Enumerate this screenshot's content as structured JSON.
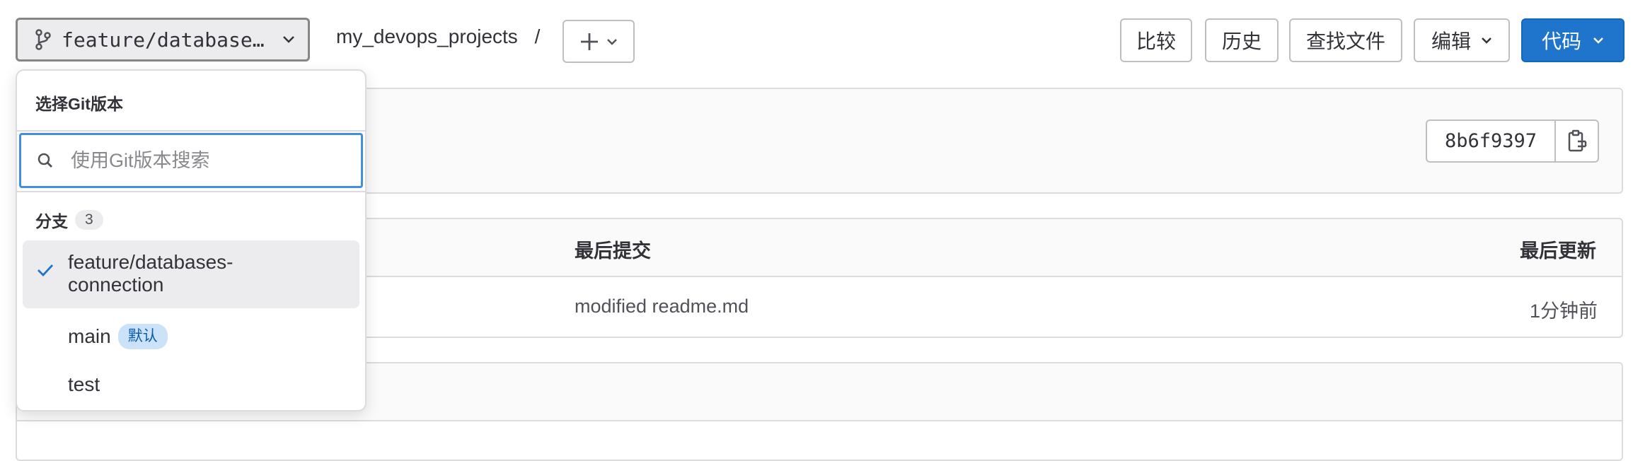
{
  "toolbar": {
    "branch_label": "feature/database…",
    "breadcrumb_project": "my_devops_projects",
    "breadcrumb_sep": "/",
    "compare_label": "比较",
    "history_label": "历史",
    "find_file_label": "查找文件",
    "edit_label": "编辑",
    "code_label": "代码"
  },
  "commit": {
    "sha": "8b6f9397"
  },
  "table": {
    "headers": {
      "last_commit": "最后提交",
      "last_update": "最后更新"
    },
    "row": {
      "commit_message": "modified readme.md",
      "updated": "1分钟前"
    }
  },
  "dropdown": {
    "title": "选择Git版本",
    "search_placeholder": "使用Git版本搜索",
    "group_label": "分支",
    "group_count": "3",
    "items": [
      {
        "line1": "feature/databases-",
        "line2": "connection",
        "selected": true
      },
      {
        "name": "main",
        "badge": "默认"
      },
      {
        "name": "test"
      }
    ]
  },
  "colors": {
    "primary": "#1f75cb",
    "focus": "#428fdc",
    "badge_bg": "#cbe2f9"
  },
  "icons": [
    "branch-icon",
    "chevron-down-icon",
    "plus-icon",
    "copy-icon",
    "search-icon",
    "check-icon"
  ]
}
